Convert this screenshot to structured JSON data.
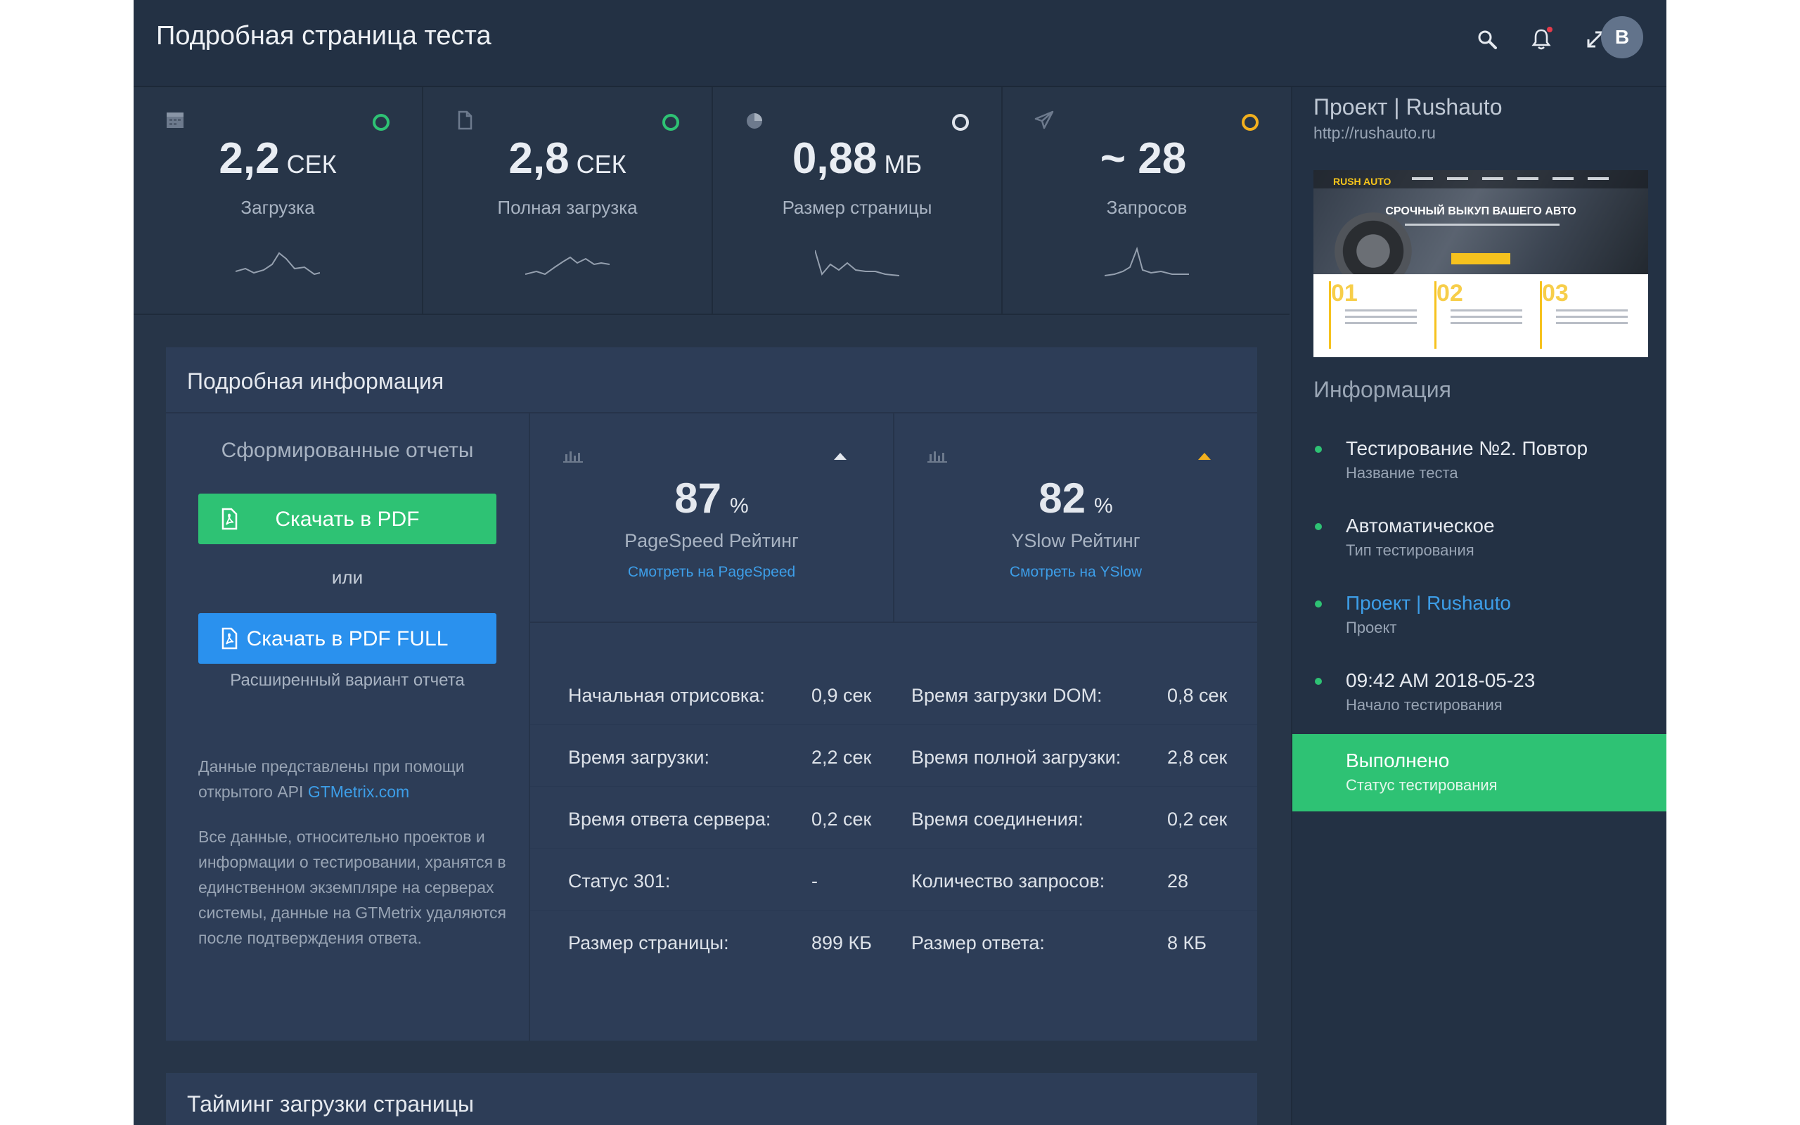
{
  "header": {
    "title": "Подробная страница теста",
    "avatar_letter": "B"
  },
  "stats": [
    {
      "value": "2,2",
      "unit": "СЕК",
      "label": "Загрузка",
      "icon": "calendar-icon",
      "status_color": "#2ec274"
    },
    {
      "value": "2,8",
      "unit": "СЕК",
      "label": "Полная загрузка",
      "icon": "file-icon",
      "status_color": "#2ec274"
    },
    {
      "value": "0,88",
      "unit": "МБ",
      "label": "Размер страницы",
      "icon": "pie-chart-icon",
      "status_color": "#dfe4ec"
    },
    {
      "value": "~ 28",
      "unit": "",
      "label": "Запросов",
      "icon": "paper-plane-icon",
      "status_color": "#f2b01e"
    }
  ],
  "details": {
    "title": "Подробная информация",
    "reports_title": "Сформированные отчеты",
    "pdf_button": "Скачать в PDF",
    "or": "или",
    "pdf_full_button": "Скачать в PDF FULL",
    "extended_note": "Расширенный вариант отчета",
    "api_note_prefix": "Данные представлены при помощи открытого API ",
    "api_link": "GTMetrix.com",
    "storage_note": "Все данные, относительно проектов и информации о тестировании, хранятся в единственном экземпляре на серверах системы, данные на GTMetrix удаляются после подтверждения ответа.",
    "pagespeed": {
      "score": "87",
      "pct": "%",
      "name": "PageSpeed Рейтинг",
      "link": "Смотреть на PageSpeed",
      "trend": "up",
      "trend_color": "#e4e8ee"
    },
    "yslow": {
      "score": "82",
      "pct": "%",
      "name": "YSlow Рейтинг",
      "link": "Смотреть на YSlow",
      "trend": "up",
      "trend_color": "#f2b01e"
    },
    "metrics": [
      {
        "k1": "Начальная отрисовка:",
        "v1": "0,9 сек",
        "k2": "Время загрузки DOM:",
        "v2": "0,8 сек"
      },
      {
        "k1": "Время загрузки:",
        "v1": "2,2 сек",
        "k2": "Время полной загрузки:",
        "v2": "2,8 сек"
      },
      {
        "k1": "Время ответа сервера:",
        "v1": "0,2 сек",
        "k2": "Время соединения:",
        "v2": "0,2 сек"
      },
      {
        "k1": "Статус 301:",
        "v1": "-",
        "k2": "Количество запросов:",
        "v2": "28"
      },
      {
        "k1": "Размер страницы:",
        "v1": "899 КБ",
        "k2": "Размер ответа:",
        "v2": "8 КБ"
      }
    ]
  },
  "timing": {
    "title": "Тайминг загрузки страницы"
  },
  "sidebar": {
    "project_title": "Проект | Rushauto",
    "project_url": "http://rushauto.ru",
    "thumbnail": {
      "brand": "RUSH AUTO",
      "headline": "СРОЧНЫЙ ВЫКУП ВАШЕГО АВТО",
      "cols": [
        "01",
        "02",
        "03"
      ]
    },
    "info_title": "Информация",
    "items": [
      {
        "main": "Тестирование №2. Повтор",
        "sub": "Название теста"
      },
      {
        "main": "Автоматическое",
        "sub": "Тип тестирования"
      },
      {
        "main": "Проект | Rushauto",
        "sub": "Проект"
      },
      {
        "main": "09:42 AM 2018-05-23",
        "sub": "Начало тестирования"
      }
    ],
    "status": {
      "main": "Выполнено",
      "sub": "Статус тестирования",
      "color": "#2ec274"
    }
  }
}
